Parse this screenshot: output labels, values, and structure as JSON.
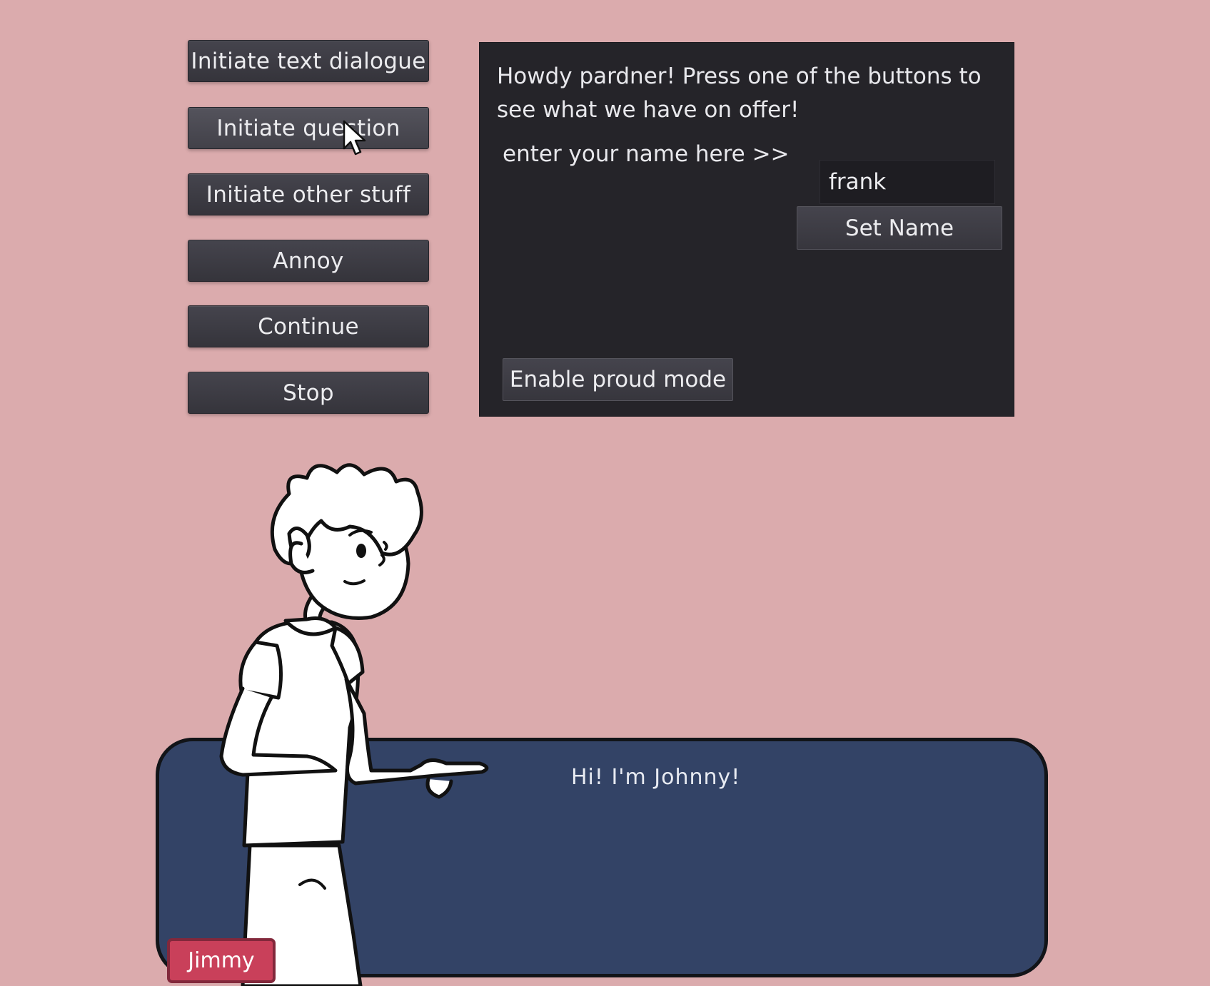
{
  "menu": {
    "buttons": [
      {
        "label": "Initiate text dialogue"
      },
      {
        "label": "Initiate question"
      },
      {
        "label": "Initiate other stuff"
      },
      {
        "label": "Annoy"
      },
      {
        "label": "Continue"
      },
      {
        "label": "Stop"
      }
    ]
  },
  "panel": {
    "intro_text": "Howdy pardner! Press one of the buttons to see what we have on offer!",
    "name_prompt": "enter your name here >>",
    "name_value": "frank",
    "set_name_label": "Set Name",
    "proud_mode_label": "Enable proud mode"
  },
  "dialogue": {
    "text": "Hi! I'm Johnny!",
    "speaker": "Jimmy"
  },
  "icons": {
    "cursor": "mouse-pointer-icon",
    "character": "cartoon-boy-pointing"
  },
  "colors": {
    "background": "#dbabad",
    "button": "#3b3a41",
    "panel": "#252429",
    "dialog_box": "#334366",
    "name_tag": "#c9405a"
  }
}
